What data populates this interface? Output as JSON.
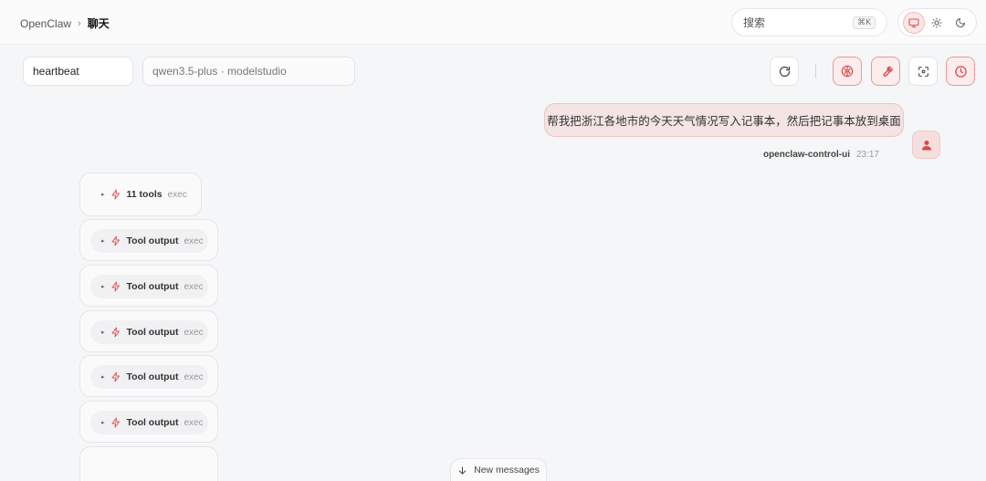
{
  "breadcrumb": {
    "root": "OpenClaw",
    "separator": "›",
    "current": "聊天"
  },
  "search": {
    "label": "搜索",
    "shortcut": "⌘K"
  },
  "theme": {
    "options": [
      "monitor-icon",
      "sun-icon",
      "moon-icon"
    ],
    "active": "monitor-icon"
  },
  "session": {
    "value": "heartbeat"
  },
  "model": {
    "value": "qwen3.5-plus · modelstudio"
  },
  "toolbar": {
    "buttons": [
      "refresh-icon",
      "brain-icon",
      "wrench-icon",
      "focus-icon",
      "clock-icon"
    ]
  },
  "message": {
    "text": "帮我把浙江各地市的今天天气情况写入记事本，然后把记事本放到桌面",
    "sender": "openclaw-control-ui",
    "time": "23:17"
  },
  "tools": {
    "summary": {
      "caret": "▸",
      "label": "11 tools",
      "type": "exec"
    },
    "outputs": [
      {
        "caret": "▸",
        "label": "Tool output",
        "type": "exec"
      },
      {
        "caret": "▸",
        "label": "Tool output",
        "type": "exec"
      },
      {
        "caret": "▸",
        "label": "Tool output",
        "type": "exec"
      },
      {
        "caret": "▸",
        "label": "Tool output",
        "type": "exec"
      },
      {
        "caret": "▸",
        "label": "Tool output",
        "type": "exec"
      }
    ]
  },
  "new_messages": {
    "label": "New messages"
  },
  "colors": {
    "accent": "#e05252",
    "accent_soft": "#fdecec",
    "bubble": "#f4e4e4"
  }
}
